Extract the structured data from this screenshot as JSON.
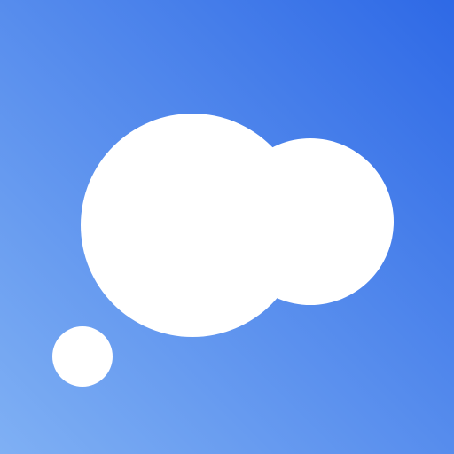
{
  "icon": {
    "name": "thought-bubble-icon",
    "colors": {
      "gradient_start": "#7FB0F4",
      "gradient_end": "#2E69E6",
      "bubble": "#FFFFFF"
    }
  }
}
